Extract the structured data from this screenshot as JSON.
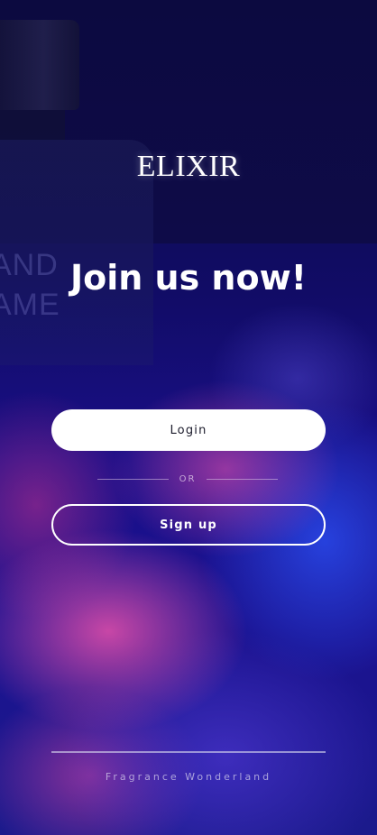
{
  "brand": {
    "name": "ELIXIR"
  },
  "hero": {
    "headline": "Join us now!"
  },
  "bottle_label": {
    "line1": "AND",
    "line2": "AME"
  },
  "actions": {
    "login_label": "Login",
    "divider_label": "OR",
    "signup_label": "Sign up"
  },
  "footer": {
    "tagline": "Fragrance Wonderland"
  },
  "colors": {
    "primary_button_bg": "#ffffff",
    "primary_button_text": "#1a1a2a",
    "background_dark": "#0b0a3e",
    "smoke_pink": "#e650aa",
    "smoke_blue": "#2846e6"
  }
}
